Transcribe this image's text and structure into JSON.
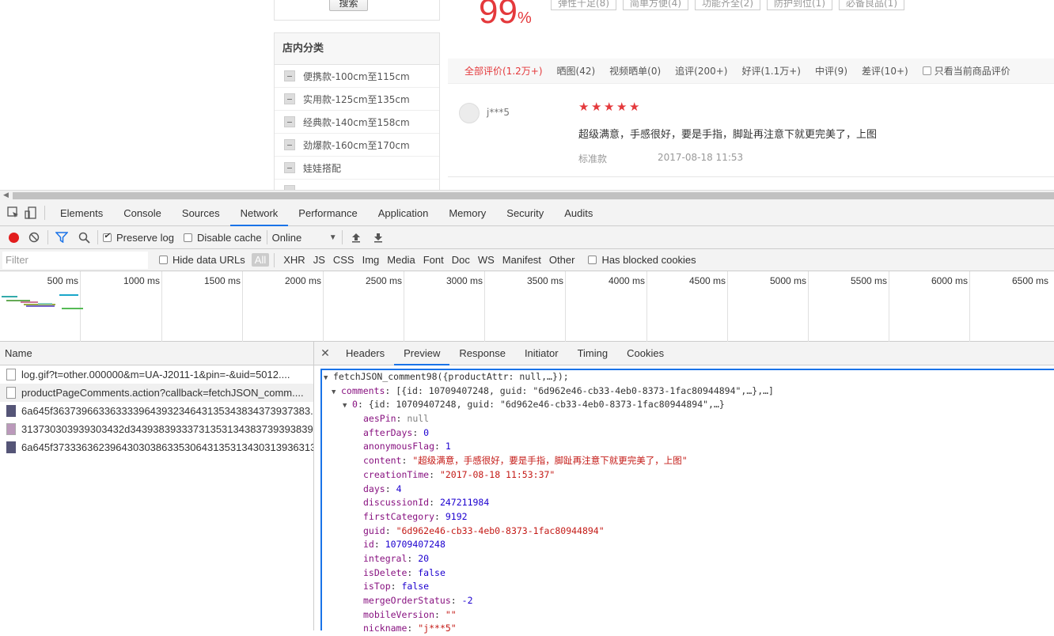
{
  "web": {
    "search_button": "搜索",
    "good_rate": "99",
    "good_rate_unit": "%",
    "tags": [
      "弹性十足(8)",
      "简单方便(4)",
      "功能齐全(2)",
      "防护到位(1)",
      "必备良品(1)"
    ],
    "category_title": "店内分类",
    "categories": [
      "便携款-100cm至115cm",
      "实用款-125cm至135cm",
      "经典款-140cm至158cm",
      "劲爆款-160cm至170cm",
      "娃娃搭配",
      "..."
    ],
    "review_tabs": [
      "全部评价(1.2万+)",
      "晒图(42)",
      "视频晒单(0)",
      "追评(200+)",
      "好评(1.1万+)",
      "中评(9)",
      "差评(10+)"
    ],
    "only_current": "只看当前商品评价",
    "review": {
      "user": "j***5",
      "stars": 5,
      "content": "超级满意，手感很好，要是手指，脚趾再注意下就更完美了，上图",
      "spec": "标准款",
      "time": "2017-08-18 11:53"
    }
  },
  "devtools": {
    "tabs": [
      "Elements",
      "Console",
      "Sources",
      "Network",
      "Performance",
      "Application",
      "Memory",
      "Security",
      "Audits"
    ],
    "active_tab": "Network",
    "toolbar": {
      "preserve_log": "Preserve log",
      "disable_cache": "Disable cache",
      "throttle": "Online"
    },
    "filter": {
      "placeholder": "Filter",
      "hide_data_urls": "Hide data URLs",
      "types": [
        "All",
        "XHR",
        "JS",
        "CSS",
        "Img",
        "Media",
        "Font",
        "Doc",
        "WS",
        "Manifest",
        "Other"
      ],
      "blocked": "Has blocked cookies"
    },
    "timeline_ticks": [
      "500 ms",
      "1000 ms",
      "1500 ms",
      "2000 ms",
      "2500 ms",
      "3000 ms",
      "3500 ms",
      "4000 ms",
      "4500 ms",
      "5000 ms",
      "5500 ms",
      "6000 ms",
      "6500 ms"
    ],
    "name_header": "Name",
    "requests": [
      "log.gif?t=other.000000&m=UA-J2011-1&pin=-&uid=5012....",
      "productPageComments.action?callback=fetchJSON_comm....",
      "6a645f363739663363333964393234643135343834373937383...",
      "313730303939303432d34393839333731353134383739393839...",
      "6a645f3733363623964303038633530643135313430313936313..."
    ],
    "detail_tabs": [
      "Headers",
      "Preview",
      "Response",
      "Initiator",
      "Timing",
      "Cookies"
    ],
    "preview": {
      "line0": "fetchJSON_comment98({productAttr: null,…});",
      "comments_key": "comments",
      "comments_summary": "[{id: 10709407248, guid: \"6d962e46-cb33-4eb0-8373-1fac80944894\",…},…]",
      "item0_key": "0",
      "item0_summary": "{id: 10709407248, guid: \"6d962e46-cb33-4eb0-8373-1fac80944894\",…}",
      "fields": [
        {
          "k": "aesPin",
          "v": "null",
          "t": "nl"
        },
        {
          "k": "afterDays",
          "v": "0",
          "t": "nv"
        },
        {
          "k": "anonymousFlag",
          "v": "1",
          "t": "nv"
        },
        {
          "k": "content",
          "v": "\"超级满意，手感很好，要是手指，脚趾再注意下就更完美了，上图\"",
          "t": "sv"
        },
        {
          "k": "creationTime",
          "v": "\"2017-08-18 11:53:37\"",
          "t": "sv"
        },
        {
          "k": "days",
          "v": "4",
          "t": "nv"
        },
        {
          "k": "discussionId",
          "v": "247211984",
          "t": "nv"
        },
        {
          "k": "firstCategory",
          "v": "9192",
          "t": "nv"
        },
        {
          "k": "guid",
          "v": "\"6d962e46-cb33-4eb0-8373-1fac80944894\"",
          "t": "sv"
        },
        {
          "k": "id",
          "v": "10709407248",
          "t": "nv"
        },
        {
          "k": "integral",
          "v": "20",
          "t": "nv"
        },
        {
          "k": "isDelete",
          "v": "false",
          "t": "nv"
        },
        {
          "k": "isTop",
          "v": "false",
          "t": "nv"
        },
        {
          "k": "mergeOrderStatus",
          "v": "-2",
          "t": "nv"
        },
        {
          "k": "mobileVersion",
          "v": "\"\"",
          "t": "sv"
        },
        {
          "k": "nickname",
          "v": "\"j***5\"",
          "t": "sv"
        }
      ]
    }
  }
}
